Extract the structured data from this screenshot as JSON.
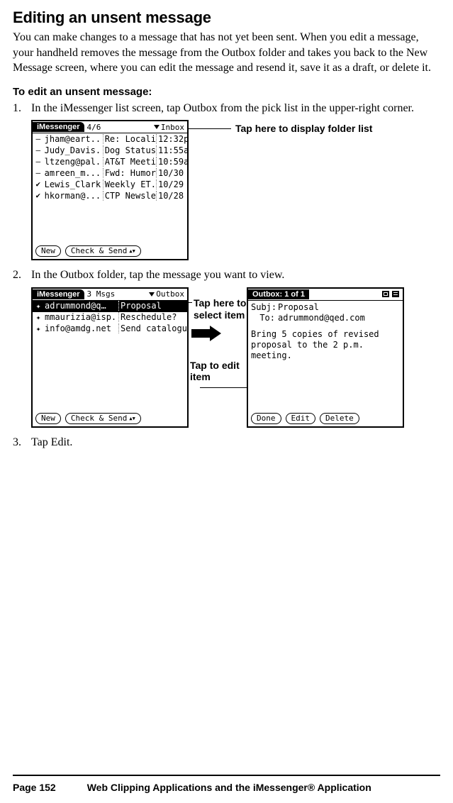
{
  "heading": "Editing an unsent message",
  "intro": "You can make changes to a message that has not yet been sent. When you edit a message, your handheld removes the message from the Outbox folder and takes you back to the New Message screen, where you can edit the message and resend it, save it as a draft, or delete it.",
  "subheading": "To edit an unsent message:",
  "steps": {
    "s1_num": "1.",
    "s1_text": "In the iMessenger list screen, tap Outbox from the pick list in the upper-right corner.",
    "s2_num": "2.",
    "s2_text": "In the Outbox folder, tap the message you want to view.",
    "s3_num": "3.",
    "s3_text": "Tap Edit."
  },
  "callouts": {
    "folder_list": "Tap here to display folder list",
    "select_item": "Tap here to select item",
    "edit_item": "Tap to edit item"
  },
  "palm_inbox": {
    "app": "iMessenger",
    "counter": "4/6",
    "folder": "Inbox",
    "rows": [
      {
        "icon": "—",
        "from": "jham@eart...",
        "subj": "Re: Localiza...",
        "time": "12:32p"
      },
      {
        "icon": "—",
        "from": "Judy_Davis...",
        "subj": "Dog Status",
        "time": "11:55a"
      },
      {
        "icon": "—",
        "from": "ltzeng@pal...",
        "subj": "AT&T Meeti...",
        "time": "10:59a"
      },
      {
        "icon": "—",
        "from": "amreen_m...",
        "subj": "Fwd: Humor",
        "time": "10/30"
      },
      {
        "icon": "✔",
        "from": "Lewis_Clark...",
        "subj": "Weekly ET...",
        "time": "10/29"
      },
      {
        "icon": "✔",
        "from": "hkorman@...",
        "subj": "CTP Newsle...",
        "time": "10/28"
      }
    ],
    "btn_new": "New",
    "btn_check": "Check & Send"
  },
  "palm_outbox": {
    "app": "iMessenger",
    "counter": "3 Msgs",
    "folder": "Outbox",
    "rows": [
      {
        "icon": "✦",
        "from": "adrummond@q…",
        "subj": "Proposal",
        "hi": true
      },
      {
        "icon": "✦",
        "from": "mmaurizia@isp....",
        "subj": "Reschedule?",
        "hi": false
      },
      {
        "icon": "✦",
        "from": "info@amdg.net",
        "subj": "Send catalogue",
        "hi": false
      }
    ],
    "btn_new": "New",
    "btn_check": "Check & Send"
  },
  "palm_detail": {
    "title": "Outbox: 1 of 1",
    "subj_label": "Subj:",
    "subj": "Proposal",
    "to_label": "To:",
    "to": "adrummond@qed.com",
    "body": "Bring 5 copies of revised proposal to the 2 p.m. meeting.",
    "btn_done": "Done",
    "btn_edit": "Edit",
    "btn_delete": "Delete"
  },
  "footer": {
    "page": "Page 152",
    "chapter": "Web Clipping Applications and the iMessenger® Application"
  }
}
